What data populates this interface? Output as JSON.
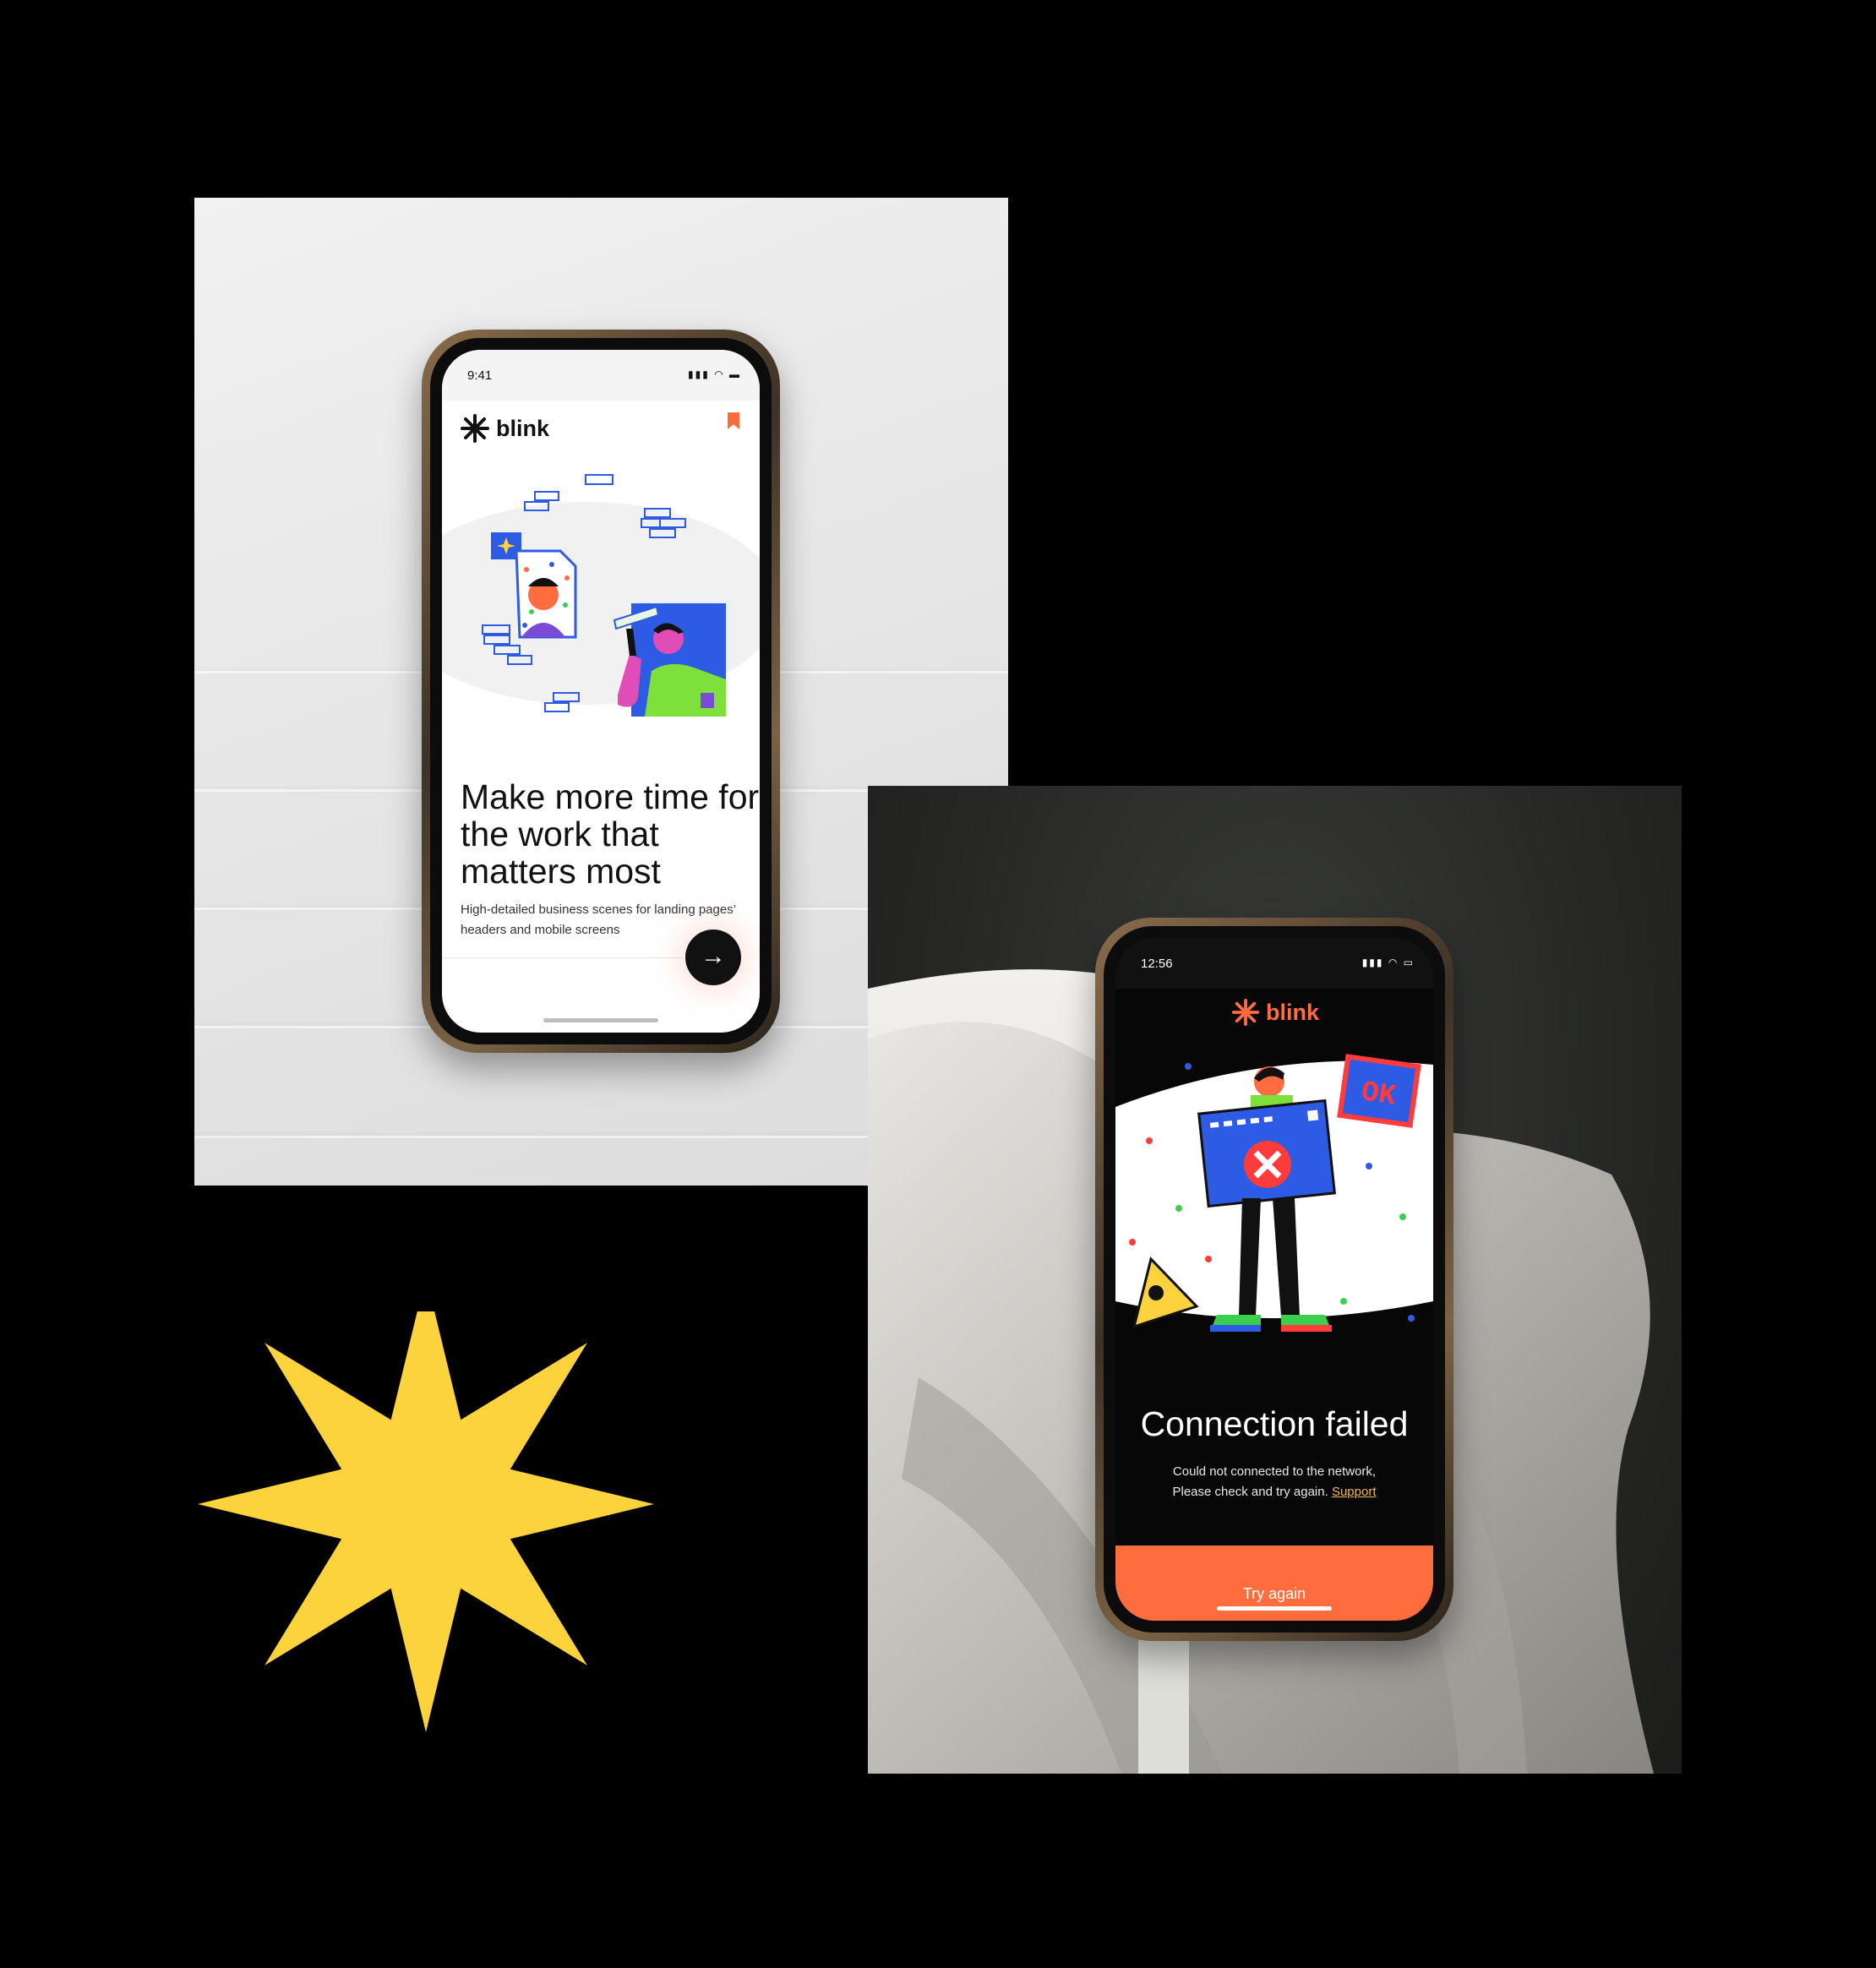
{
  "colors": {
    "accent_orange": "#ff6c3e",
    "star_yellow": "#fdd33d",
    "link_yellow": "#f2b84b"
  },
  "left_phone": {
    "status_time": "9:41",
    "brand": "blink",
    "headline": "Make more time for the work that matters most",
    "subtext": "High-detailed business scenes for landing pages’ headers and mobile screens",
    "icons": [
      "blink-star-icon",
      "bookmark-icon",
      "arrow-right-icon"
    ]
  },
  "right_phone": {
    "status_time": "12:56",
    "brand": "blink",
    "ok_sign": "OK",
    "error_title": "Connection failed",
    "error_line1": "Could not connected to the network,",
    "error_line2": "Please check and try again.",
    "support_link": "Support",
    "button_label": "Try again"
  }
}
